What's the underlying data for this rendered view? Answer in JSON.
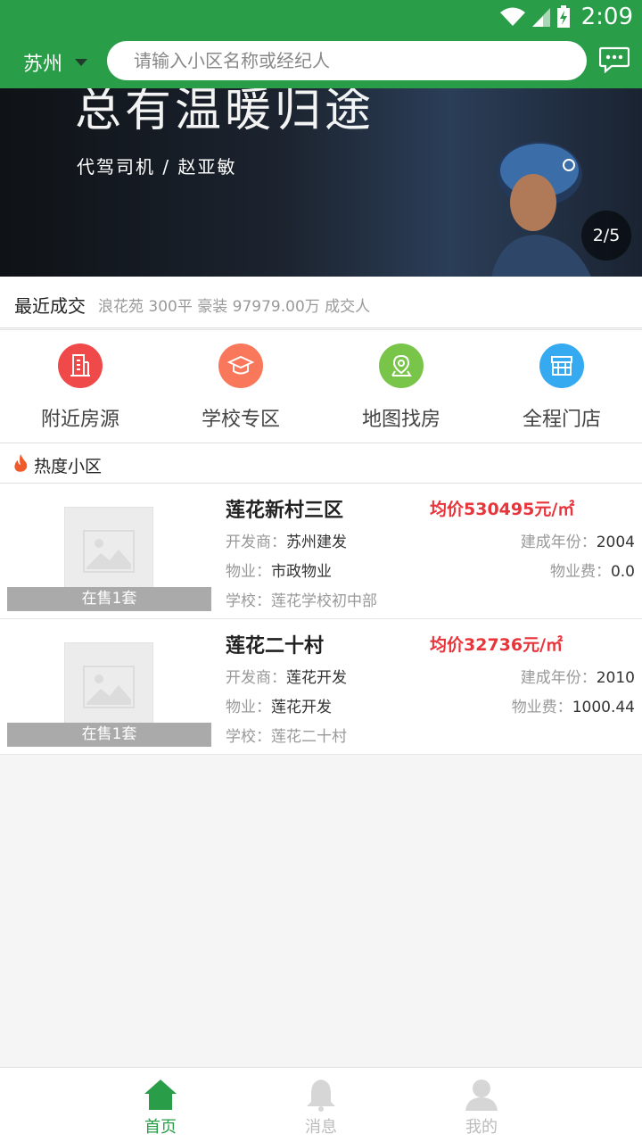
{
  "status_bar": {
    "time": "2:09"
  },
  "header": {
    "city": "苏州",
    "search_placeholder": "请输入小区名称或经纪人"
  },
  "banner": {
    "headline": "总有温暖归途",
    "subline": "代驾司机 / 赵亚敏",
    "counter": "2/5"
  },
  "recent": {
    "label": "最近成交",
    "info": "浪花苑 300平 豪装 97979.00万 成交人"
  },
  "menu": [
    {
      "label": "附近房源",
      "color": "#f0494a"
    },
    {
      "label": "学校专区",
      "color": "#f9775a"
    },
    {
      "label": "地图找房",
      "color": "#79c54a"
    },
    {
      "label": "全程门店",
      "color": "#35aaf0"
    }
  ],
  "hot": {
    "title": "热度小区"
  },
  "communities": [
    {
      "name": "莲花新村三区",
      "price": "均价530495元/㎡",
      "developer_label": "开发商：",
      "developer": "苏州建发",
      "year_label": "建成年份：",
      "year": "2004",
      "property_label": "物业：",
      "property": "市政物业",
      "fee_label": "物业费：",
      "fee": "0.0",
      "school": "学校：莲花学校初中部",
      "onsale": "在售1套"
    },
    {
      "name": "莲花二十村",
      "price": "均价32736元/㎡",
      "developer_label": "开发商：",
      "developer": "莲花开发",
      "year_label": "建成年份：",
      "year": "2010",
      "property_label": "物业：",
      "property": "莲花开发",
      "fee_label": "物业费：",
      "fee": "1000.44",
      "school": "学校：莲花二十村",
      "onsale": "在售1套"
    }
  ],
  "tabs": [
    {
      "label": "首页",
      "active": true
    },
    {
      "label": "消息",
      "active": false
    },
    {
      "label": "我的",
      "active": false
    }
  ],
  "colors": {
    "brand": "#2a9d49",
    "price": "#e8353b"
  }
}
